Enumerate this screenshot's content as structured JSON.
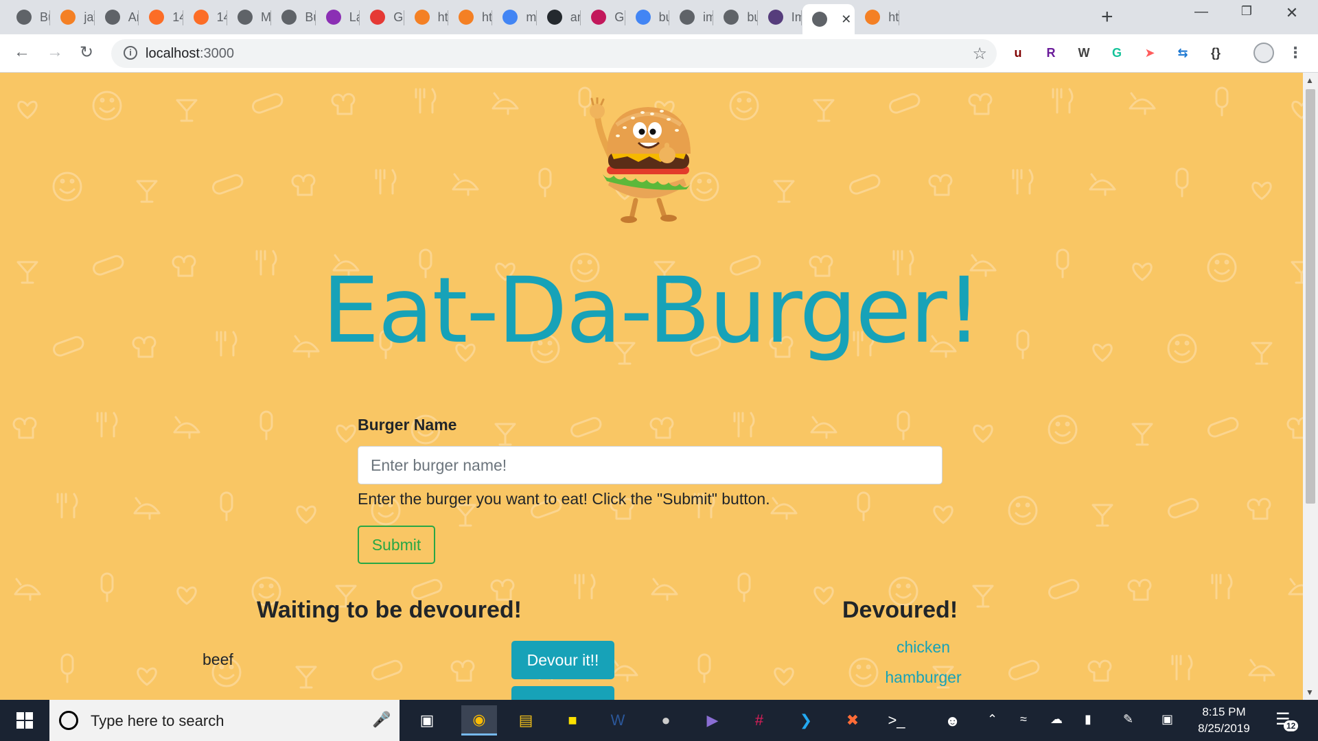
{
  "browser": {
    "tabs": [
      {
        "label": "Bu",
        "icon": "globe-icon",
        "color": "#5f6368"
      },
      {
        "label": "jav",
        "icon": "stackoverflow-icon",
        "color": "#f48024"
      },
      {
        "label": "An",
        "icon": "globe-icon",
        "color": "#5f6368"
      },
      {
        "label": "14",
        "icon": "gitlab-icon",
        "color": "#fc6d26"
      },
      {
        "label": "14",
        "icon": "gitlab-icon",
        "color": "#fc6d26"
      },
      {
        "label": "M",
        "icon": "globe-icon",
        "color": "#5f6368"
      },
      {
        "label": "Bu",
        "icon": "globe-icon",
        "color": "#5f6368"
      },
      {
        "label": "La",
        "icon": "freecodecamp-icon",
        "color": "#8b2fb4"
      },
      {
        "label": "Go",
        "icon": "f-icon",
        "color": "#e53935"
      },
      {
        "label": "htt",
        "icon": "stackoverflow-icon",
        "color": "#f48024"
      },
      {
        "label": "htt",
        "icon": "stackoverflow-icon",
        "color": "#f48024"
      },
      {
        "label": "ma",
        "icon": "google-icon",
        "color": "#4285f4"
      },
      {
        "label": "an",
        "icon": "github-icon",
        "color": "#24292e"
      },
      {
        "label": "Gl",
        "icon": "glitch-icon",
        "color": "#c2185b"
      },
      {
        "label": "bu",
        "icon": "google-icon",
        "color": "#4285f4"
      },
      {
        "label": "im",
        "icon": "globe-icon",
        "color": "#5f6368"
      },
      {
        "label": "bu",
        "icon": "globe-icon",
        "color": "#5f6368"
      },
      {
        "label": "Im",
        "icon": "bootstrap-icon",
        "color": "#563d7c"
      },
      {
        "label": "",
        "icon": "globe-icon",
        "color": "#5f6368",
        "active": true
      },
      {
        "label": "htt",
        "icon": "stackoverflow-icon",
        "color": "#f48024"
      }
    ],
    "url_host": "localhost",
    "url_port": ":3000",
    "extensions": [
      {
        "icon": "ublock-icon",
        "glyph": "u",
        "color": "#800000"
      },
      {
        "icon": "r-icon",
        "glyph": "R",
        "color": "#6a1b9a"
      },
      {
        "icon": "w-icon",
        "glyph": "W",
        "color": "#424242"
      },
      {
        "icon": "grammarly-icon",
        "glyph": "G",
        "color": "#15c39a"
      },
      {
        "icon": "arrow-ext-icon",
        "glyph": "➤",
        "color": "#ff5c5c"
      },
      {
        "icon": "swap-ext-icon",
        "glyph": "⇆",
        "color": "#1976d2"
      },
      {
        "icon": "braces-ext-icon",
        "glyph": "{}",
        "color": "#333333"
      }
    ]
  },
  "page": {
    "title": "Eat-Da-Burger!",
    "form": {
      "label": "Burger Name",
      "placeholder": "Enter burger name!",
      "help": "Enter the burger you want to eat! Click the \"Submit\" button.",
      "submit": "Submit"
    },
    "waiting": {
      "heading": "Waiting to be devoured!",
      "items": [
        {
          "name": "beef",
          "button": "Devour it!!"
        }
      ],
      "partial_button": ""
    },
    "devoured": {
      "heading": "Devoured!",
      "items": [
        "chicken",
        "hamburger"
      ]
    },
    "colors": {
      "background": "#f9c664",
      "accent": "#17a2b8",
      "success": "#28a745"
    }
  },
  "taskbar": {
    "search_placeholder": "Type here to search",
    "apps": [
      "task-view-icon",
      "chrome-icon",
      "file-explorer-icon",
      "sticky-notes-icon",
      "word-icon",
      "github-desktop-icon",
      "visual-studio-icon",
      "slack-icon",
      "vscode-icon",
      "postman-icon",
      "terminal-icon"
    ],
    "time": "8:15 PM",
    "date": "8/25/2019",
    "notifications": "12"
  }
}
